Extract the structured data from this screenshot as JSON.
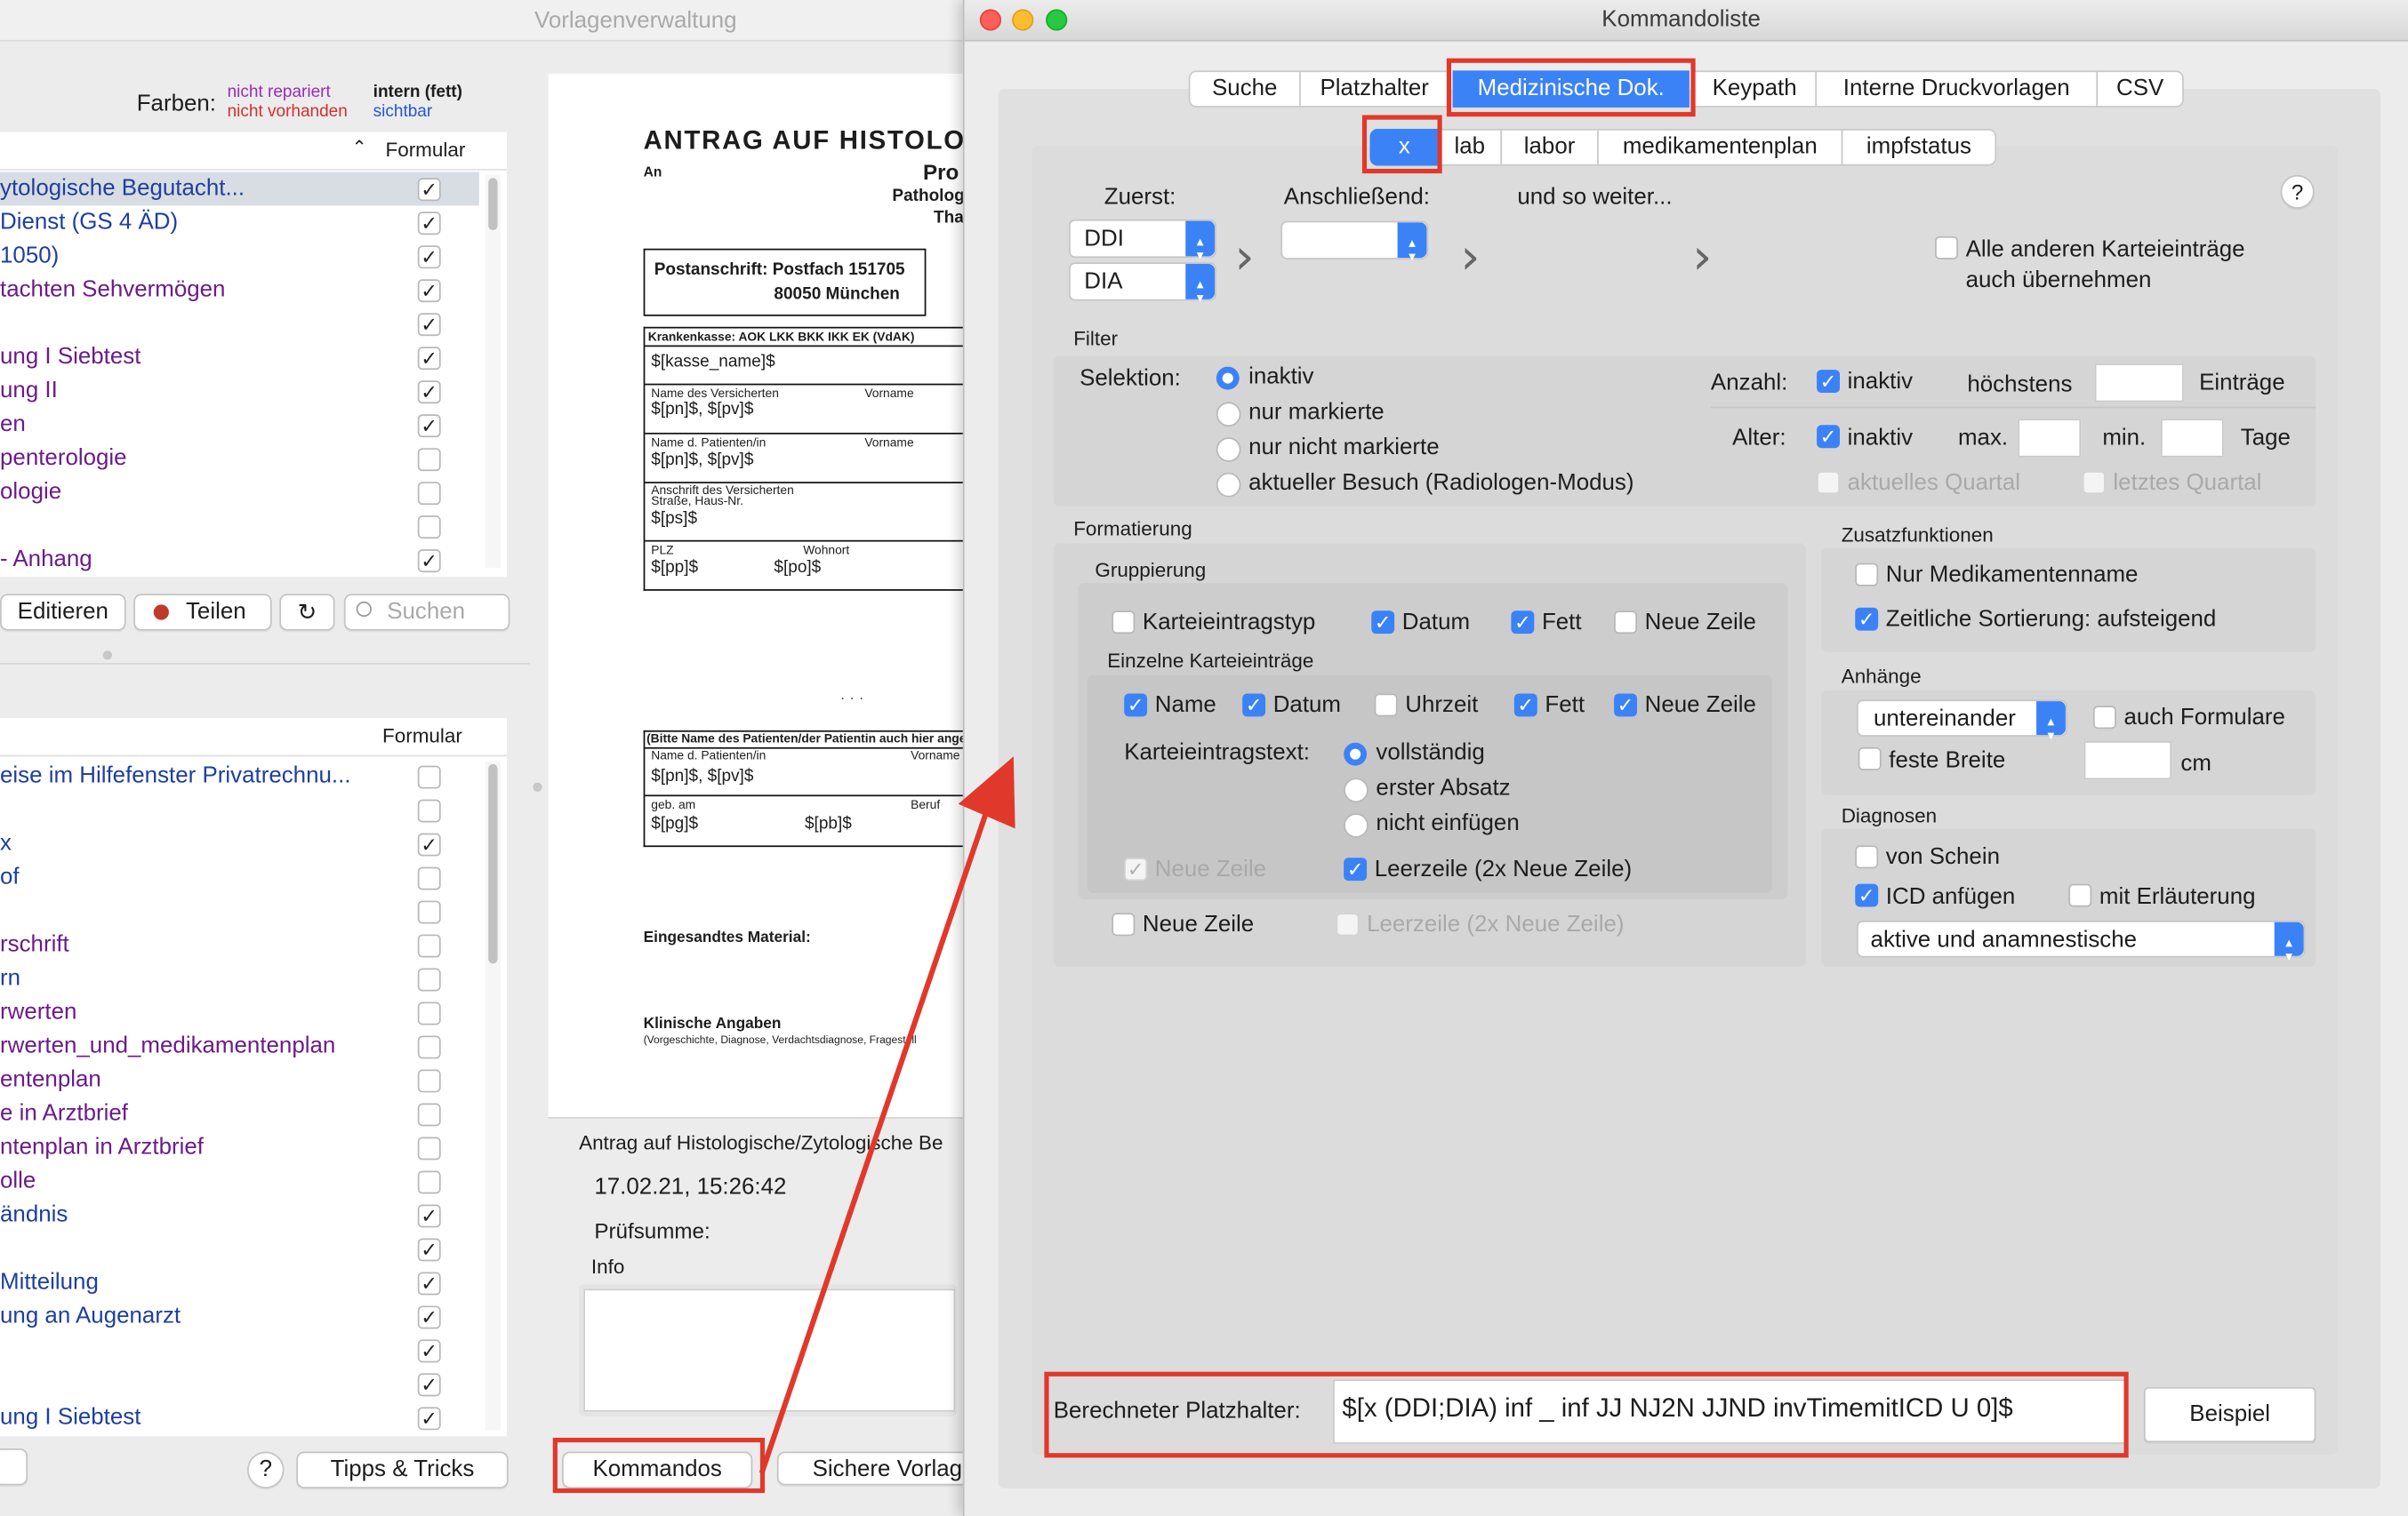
{
  "background_window": {
    "title": "Vorlagenverwaltung",
    "farben_label": "Farben:",
    "legend": {
      "not_repaired": "nicht repariert",
      "not_present": "nicht vorhanden",
      "internal": "intern (fett)",
      "visible": "sichtbar"
    },
    "colors": {
      "not_repaired": "#9b2bb5",
      "not_present": "#d0312d",
      "visible": "#2355d9",
      "list_blue": "#1f3f9e",
      "list_purple": "#6b1c8a"
    },
    "column_formular": "Formular",
    "top_list": [
      {
        "label": "ytologische Begutacht...",
        "checked": true,
        "color": "blue"
      },
      {
        "label": "Dienst (GS 4 ÄD)",
        "checked": true,
        "color": "blue"
      },
      {
        "label": "1050)",
        "checked": true,
        "color": "blue"
      },
      {
        "label": "tachten Sehvermögen",
        "checked": true,
        "color": "purple"
      },
      {
        "label": "",
        "checked": true,
        "color": "blue"
      },
      {
        "label": "ung I Siebtest",
        "checked": true,
        "color": "purple"
      },
      {
        "label": "ung II",
        "checked": true,
        "color": "purple"
      },
      {
        "label": "en",
        "checked": true,
        "color": "purple"
      },
      {
        "label": "penterologie",
        "checked": false,
        "color": "purple"
      },
      {
        "label": "ologie",
        "checked": false,
        "color": "purple"
      },
      {
        "label": "",
        "checked": false,
        "color": "blue"
      },
      {
        "label": "- Anhang",
        "checked": true,
        "color": "purple"
      }
    ],
    "toolbar": {
      "edit": "Editieren",
      "share": "Teilen",
      "search_placeholder": "Suchen"
    },
    "bottom_list": [
      {
        "label": "eise im Hilfefenster Privatrechnu...",
        "checked": false,
        "color": "blue"
      },
      {
        "label": "",
        "checked": false,
        "color": "blue"
      },
      {
        "label": "x",
        "checked": true,
        "color": "blue"
      },
      {
        "label": "of",
        "checked": false,
        "color": "blue"
      },
      {
        "label": "",
        "checked": false,
        "color": "blue"
      },
      {
        "label": "rschrift",
        "checked": false,
        "color": "purple"
      },
      {
        "label": "rn",
        "checked": false,
        "color": "blue"
      },
      {
        "label": "rwerten",
        "checked": false,
        "color": "purple"
      },
      {
        "label": "rwerten_und_medikamentenplan",
        "checked": false,
        "color": "purple"
      },
      {
        "label": "entenplan",
        "checked": false,
        "color": "purple"
      },
      {
        "label": "e in Arztbrief",
        "checked": false,
        "color": "purple"
      },
      {
        "label": "ntenplan in Arztbrief",
        "checked": false,
        "color": "purple"
      },
      {
        "label": "olle",
        "checked": false,
        "color": "purple"
      },
      {
        "label": "ändnis",
        "checked": true,
        "color": "blue"
      },
      {
        "label": "",
        "checked": true,
        "color": "blue"
      },
      {
        "label": "Mitteilung",
        "checked": true,
        "color": "blue"
      },
      {
        "label": "ung an Augenarzt",
        "checked": true,
        "color": "blue"
      },
      {
        "label": "",
        "checked": true,
        "color": "blue"
      },
      {
        "label": "",
        "checked": true,
        "color": "blue"
      },
      {
        "label": "ung I Siebtest",
        "checked": true,
        "color": "blue"
      }
    ],
    "help": "?",
    "tips": "Tipps & Tricks",
    "commands_button": "Kommandos",
    "save_button": "Sichere Vorlag",
    "doc": {
      "heading": "ANTRAG AUF HISTOLO",
      "sub1": "Pro",
      "sub2": "Patholog",
      "sub3": "Tha",
      "an": "An",
      "postanschrift": "Postanschrift: Postfach 151705",
      "city": "80050 München",
      "kasse_header": "Krankenkasse: AOK LKK BKK IKK EK (VdAK)",
      "kasse_name": "$[kasse_name]$",
      "versicherter": "Name des Versicherten",
      "vorname": "Vorname",
      "pn_pv": "$[pn]$, $[pv]$",
      "patient": "Name d. Patienten/in",
      "anschrift": "Anschrift des Versicherten",
      "strasse": "Straße, Haus-Nr.",
      "ps": "$[ps]$",
      "plz": "PLZ",
      "wohnort": "Wohnort",
      "pp": "$[pp]$",
      "po": "$[po]$",
      "dots": "· · ·",
      "bitte": "(Bitte Name des Patienten/der Patientin auch hier ange",
      "geb": "geb. am",
      "beruf": "Beruf",
      "pg": "$[pg]$",
      "pb": "$[pb]$",
      "material": "Eingesandtes Material:",
      "klinisch": "Klinische Angaben",
      "klinisch_sub": "(Vorgeschichte, Diagnose, Verdachtsdiagnose, Fragestell"
    },
    "info_panel": {
      "doc_name": "Antrag auf Histologische/Zytologische Be",
      "timestamp": "17.02.21, 15:26:42",
      "checksum_label": "Prüfsumme:",
      "info_label": "Info"
    }
  },
  "dialog": {
    "title": "Kommandoliste",
    "tabs": [
      "Suche",
      "Platzhalter",
      "Medizinische Dok.",
      "Keypath",
      "Interne Druckvorlagen",
      "CSV"
    ],
    "selected_tab": "Medizinische Dok.",
    "subtabs": [
      "x",
      "lab",
      "labor",
      "medikamentenplan",
      "impfstatus"
    ],
    "selected_subtab": "x",
    "help": "?",
    "zuerst_label": "Zuerst:",
    "anschliessend_label": "Anschließend:",
    "und_so_weiter": "und so weiter...",
    "zuerst_values": [
      "DDI",
      "DIA"
    ],
    "andere_eintraege": "Alle anderen Karteieinträge auch übernehmen",
    "filter": {
      "title": "Filter",
      "selektion_label": "Selektion:",
      "radio_options": [
        "inaktiv",
        "nur markierte",
        "nur nicht markierte",
        "aktueller Besuch (Radiologen-Modus)"
      ],
      "selected": "inaktiv",
      "anzahl_label": "Anzahl:",
      "anzahl_inaktiv": "inaktiv",
      "hoechstens": "höchstens",
      "eintraege": "Einträge",
      "alter_label": "Alter:",
      "alter_inaktiv": "inaktiv",
      "max": "max.",
      "min": "min.",
      "tage": "Tage",
      "aktuelles_quartal": "aktuelles Quartal",
      "letztes_quartal": "letztes Quartal"
    },
    "formatierung": {
      "title": "Formatierung",
      "gruppierung": "Gruppierung",
      "group_checks": [
        {
          "label": "Karteieintragstyp",
          "checked": false
        },
        {
          "label": "Datum",
          "checked": true
        },
        {
          "label": "Fett",
          "checked": true
        },
        {
          "label": "Neue Zeile",
          "checked": false
        }
      ],
      "einzelne": "Einzelne Karteieinträge",
      "entry_checks": [
        {
          "label": "Name",
          "checked": true
        },
        {
          "label": "Datum",
          "checked": true
        },
        {
          "label": "Uhrzeit",
          "checked": false
        },
        {
          "label": "Fett",
          "checked": true
        },
        {
          "label": "Neue Zeile",
          "checked": true
        }
      ],
      "text_label": "Karteieintragstext:",
      "text_options": [
        "vollständig",
        "erster Absatz",
        "nicht einfügen"
      ],
      "text_selected": "vollständig",
      "neue_zeile_disabled": "Neue Zeile",
      "leerzeile": "Leerzeile (2x Neue Zeile)",
      "bottom_neue_zeile": "Neue Zeile",
      "bottom_leerzeile": "Leerzeile (2x Neue Zeile)"
    },
    "zusatz": {
      "title": "Zusatzfunktionen",
      "nur_medikament": "Nur Medikamentenname",
      "zeitliche": "Zeitliche Sortierung: aufsteigend"
    },
    "anhaenge": {
      "title": "Anhänge",
      "select": "untereinander",
      "auch_formulare": "auch Formulare",
      "feste_breite": "feste Breite",
      "cm": "cm"
    },
    "diagnosen": {
      "title": "Diagnosen",
      "von_schein": "von Schein",
      "icd": "ICD anfügen",
      "erlaeuterung": "mit Erläuterung",
      "select": "aktive und anamnestische"
    },
    "berechnet_label": "Berechneter Platzhalter:",
    "berechnet_value": "$[x (DDI;DIA) inf _ inf JJ NJ2N JJND invTimemitICD U 0]$",
    "beispiel": "Beispiel",
    "accent": "#3b82f6",
    "highlight": "#e0392b"
  }
}
